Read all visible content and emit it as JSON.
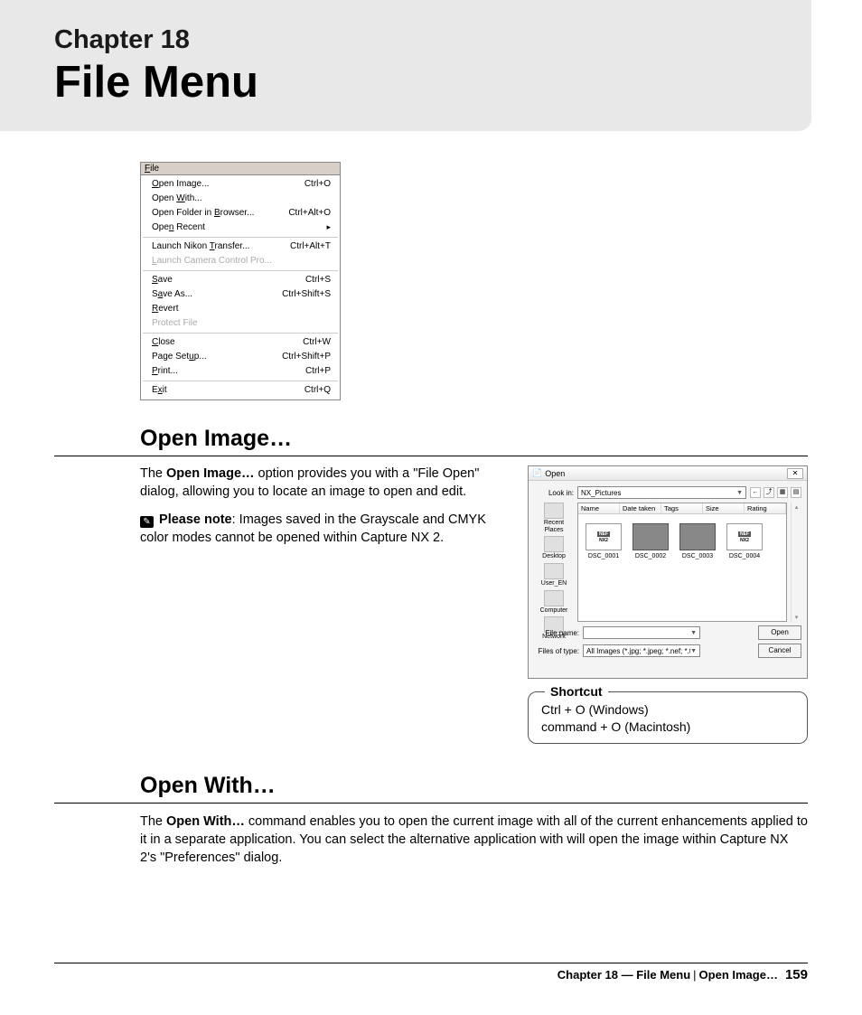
{
  "header": {
    "chapter_label": "Chapter 18",
    "title": "File Menu"
  },
  "file_menu": {
    "title": "File",
    "groups": [
      [
        {
          "label": "Open Image...",
          "u": "O",
          "shortcut": "Ctrl+O",
          "disabled": false,
          "arrow": false
        },
        {
          "label": "Open With...",
          "u": "W",
          "shortcut": "",
          "disabled": false,
          "arrow": false
        },
        {
          "label": "Open Folder in Browser...",
          "u": "B",
          "shortcut": "Ctrl+Alt+O",
          "disabled": false,
          "arrow": false
        },
        {
          "label": "Open Recent",
          "u": "n",
          "shortcut": "",
          "disabled": false,
          "arrow": true
        }
      ],
      [
        {
          "label": "Launch Nikon Transfer...",
          "u": "T",
          "shortcut": "Ctrl+Alt+T",
          "disabled": false,
          "arrow": false
        },
        {
          "label": "Launch Camera Control Pro...",
          "u": "L",
          "shortcut": "",
          "disabled": true,
          "arrow": false
        }
      ],
      [
        {
          "label": "Save",
          "u": "S",
          "shortcut": "Ctrl+S",
          "disabled": false,
          "arrow": false
        },
        {
          "label": "Save As...",
          "u": "a",
          "shortcut": "Ctrl+Shift+S",
          "disabled": false,
          "arrow": false
        },
        {
          "label": "Revert",
          "u": "R",
          "shortcut": "",
          "disabled": false,
          "arrow": false
        },
        {
          "label": "Protect File",
          "u": "",
          "shortcut": "",
          "disabled": true,
          "arrow": false
        }
      ],
      [
        {
          "label": "Close",
          "u": "C",
          "shortcut": "Ctrl+W",
          "disabled": false,
          "arrow": false
        },
        {
          "label": "Page Setup...",
          "u": "u",
          "shortcut": "Ctrl+Shift+P",
          "disabled": false,
          "arrow": false
        },
        {
          "label": "Print...",
          "u": "P",
          "shortcut": "Ctrl+P",
          "disabled": false,
          "arrow": false
        }
      ],
      [
        {
          "label": "Exit",
          "u": "x",
          "shortcut": "Ctrl+Q",
          "disabled": false,
          "arrow": false
        }
      ]
    ]
  },
  "section_open_image": {
    "heading": "Open Image…",
    "para1_pre": "The ",
    "para1_bold": "Open Image…",
    "para1_post": " option provides you with a \"File Open\" dialog, allowing you to locate an image to open and edit.",
    "note_label": "Please note",
    "note_text": ": Images saved in the Grayscale and CMYK color modes cannot be opened within Capture NX 2."
  },
  "open_dialog": {
    "title": "Open",
    "look_in_label": "Look in:",
    "look_in_value": "NX_Pictures",
    "columns": [
      "Name",
      "Date taken",
      "Tags",
      "Size",
      "Rating"
    ],
    "places": [
      "Recent Places",
      "Desktop",
      "User_EN",
      "Computer",
      "Network"
    ],
    "thumbs": [
      {
        "name": "DSC_0001",
        "nef": true
      },
      {
        "name": "DSC_0002",
        "nef": false
      },
      {
        "name": "DSC_0003",
        "nef": false
      },
      {
        "name": "DSC_0004",
        "nef": true
      }
    ],
    "file_name_label": "File name:",
    "file_name_value": "",
    "file_type_label": "Files of type:",
    "file_type_value": "All Images (*.jpg; *.jpeg; *.nef; *.tif; *.tiff)",
    "open_btn": "Open",
    "cancel_btn": "Cancel"
  },
  "shortcut_box": {
    "legend": "Shortcut",
    "line1": "Ctrl + O (Windows)",
    "line2": "command + O (Macintosh)"
  },
  "section_open_with": {
    "heading": "Open With…",
    "para_pre": "The ",
    "para_bold": "Open With…",
    "para_post": " command enables you to open the current image with all of the current enhancements applied to it in a separate application. You can select the alternative application with will open the image within Capture NX 2's \"Preferences\" dialog."
  },
  "footer": {
    "chapter": "Chapter 18 — File Menu",
    "section": "Open Image…",
    "page": "159"
  }
}
